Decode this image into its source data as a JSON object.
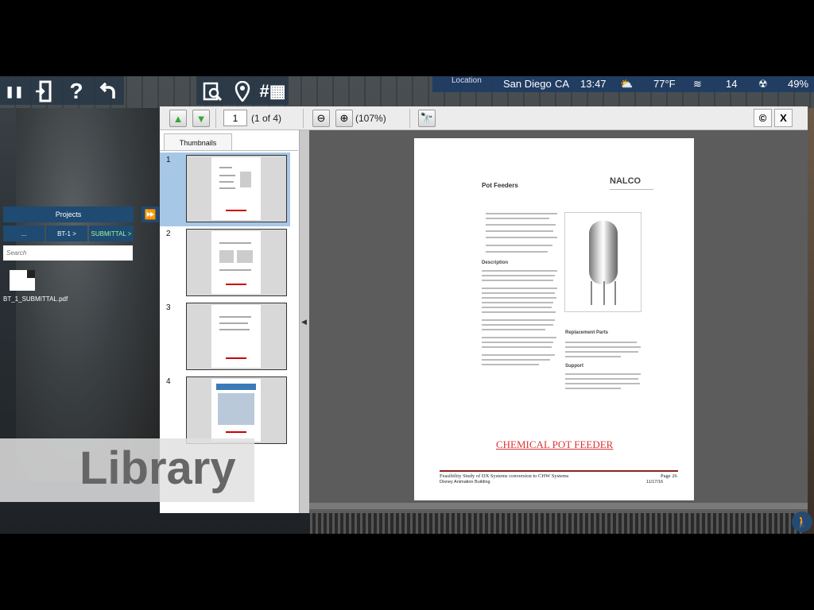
{
  "toolbar": {
    "pause_icon": "pause-icon",
    "exit_icon": "door-exit-icon",
    "help_label": "?",
    "undo_icon": "undo-arrow-icon",
    "library_icon": "document-search-icon",
    "location_icon": "map-pin-icon",
    "qr_icon": "qr-code-icon"
  },
  "status": {
    "location_label": "Location",
    "city": "San Diego",
    "state": "CA",
    "time": "13:47",
    "weather_icon": "partly-cloudy-icon",
    "temperature": "77°F",
    "wind_icon": "wind-icon",
    "wind": "14",
    "humidity_icon": "humidity-icon",
    "humidity": "49%"
  },
  "left_panel": {
    "projects_label": "Projects",
    "breadcrumbs": [
      "...",
      "BT-1 >",
      "SUBMITTAL >"
    ],
    "search_placeholder": "Search",
    "file_name": "BT_1_SUBMITTAL.pdf"
  },
  "viewer": {
    "page_input": "1",
    "page_count": "(1 of 4)",
    "zoom": "(107%)",
    "thumbnails_tab": "Thumbnails",
    "thumbnails": [
      "1",
      "2",
      "3",
      "4"
    ],
    "close_label": "X",
    "copyright_label": "©"
  },
  "document": {
    "title": "Pot Feeders",
    "logo": "NALCO",
    "description_head": "Description",
    "replacement_head": "Replacement Parts",
    "support_head": "Support",
    "caption": "CHEMICAL POT FEEDER",
    "footer_line1": "Feasibility Study of DX Systems conversion to CHW Systems",
    "footer_page": "Page 26",
    "footer_line2": "Disney Animation Building",
    "footer_date": "11/17/16"
  },
  "overlay": {
    "library_label": "Library"
  },
  "colors": {
    "panel_blue": "#1f4a72",
    "status_blue": "#1e3c64",
    "selected_thumb": "#a7c7e7",
    "caption_red": "#d33333"
  }
}
